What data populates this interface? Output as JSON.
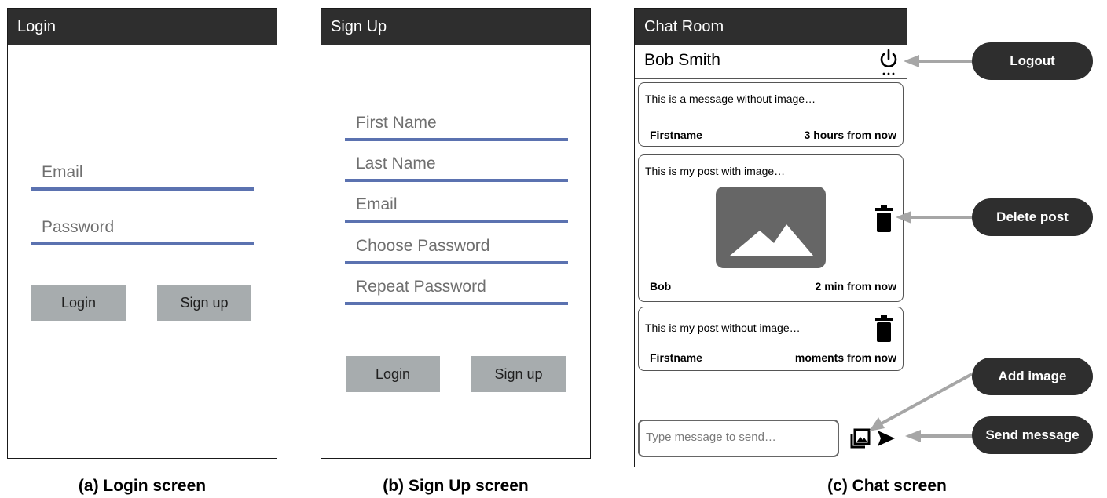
{
  "login": {
    "title": "Login",
    "email_placeholder": "Email",
    "password_placeholder": "Password",
    "login_button": "Login",
    "signup_button": "Sign up",
    "caption": "(a) Login screen"
  },
  "signup": {
    "title": "Sign Up",
    "first_name_placeholder": "First Name",
    "last_name_placeholder": "Last Name",
    "email_placeholder": "Email",
    "choose_password_placeholder": "Choose Password",
    "repeat_password_placeholder": "Repeat Password",
    "login_button": "Login",
    "signup_button": "Sign up",
    "caption": "(b) Sign Up screen"
  },
  "chat": {
    "title": "Chat Room",
    "user_name": "Bob Smith",
    "messages": [
      {
        "text": "This is a message without image…",
        "author": "Firstname",
        "time": "3 hours from now"
      },
      {
        "text": "This is my post with image…",
        "author": "Bob",
        "time": "2 min from now"
      },
      {
        "text": "This is my post without image…",
        "author": "Firstname",
        "time": "moments from now"
      }
    ],
    "input_placeholder": "Type message to send…",
    "caption": "(c) Chat screen"
  },
  "callouts": {
    "logout": "Logout",
    "delete_post": "Delete post",
    "add_image": "Add image",
    "send_message": "Send message"
  },
  "icons": [
    "power-icon",
    "trash-icon",
    "image-placeholder-icon",
    "add-image-icon",
    "send-icon"
  ],
  "colors": {
    "titlebar": "#2e2e2e",
    "field_underline": "#5b72b0",
    "button": "#a7acae",
    "arrow": "#a6a6a6"
  }
}
